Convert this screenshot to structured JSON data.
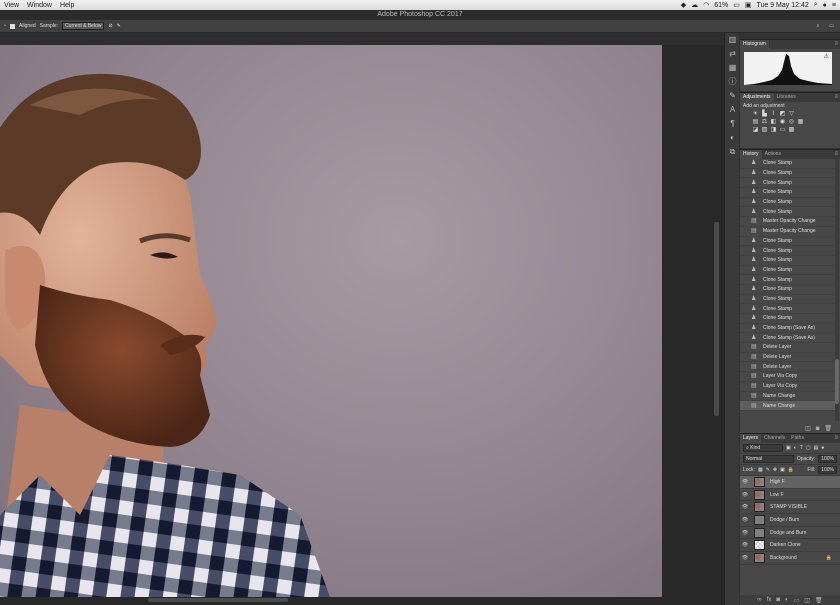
{
  "menubar": {
    "items": [
      "View",
      "Window",
      "Help"
    ],
    "status": {
      "battery": "61%",
      "datetime": "Tue 9 May  12:42"
    }
  },
  "window": {
    "title": "Adobe Photoshop CC 2017"
  },
  "options": {
    "aligned_label": "Aligned",
    "sample_label": "Sample:",
    "sample_value": "Current & Below"
  },
  "histogram": {
    "tab": "Histogram"
  },
  "adjustments": {
    "tabs": [
      "Adjustments",
      "Libraries"
    ],
    "title": "Add an adjustment"
  },
  "history": {
    "tabs": [
      "History",
      "Actions"
    ],
    "items": [
      "Clone Stamp",
      "Clone Stamp",
      "Clone Stamp",
      "Clone Stamp",
      "Clone Stamp",
      "Clone Stamp",
      "Master Opacity Change",
      "Master Opacity Change",
      "Clone Stamp",
      "Clone Stamp",
      "Clone Stamp",
      "Clone Stamp",
      "Clone Stamp",
      "Clone Stamp",
      "Clone Stamp",
      "Clone Stamp",
      "Clone Stamp",
      "Clone Stamp (Save As)",
      "Clone Stamp (Save As)",
      "Delete Layer",
      "Delete Layer",
      "Delete Layer",
      "Layer Via Copy",
      "Layer Via Copy",
      "Name Change",
      "Name Change"
    ]
  },
  "layers": {
    "tabs": [
      "Layers",
      "Channels",
      "Paths"
    ],
    "kind": "Kind",
    "blend_mode": "Normal",
    "opacity_label": "Opacity:",
    "opacity_value": "100%",
    "lock_label": "Lock:",
    "fill_label": "Fill:",
    "fill_value": "100%",
    "items": [
      "High F",
      "Low F",
      "STAMP VISIBLE",
      "Dodge / Burn",
      "Dodge and Burn",
      "Darken Clone",
      "Background"
    ]
  }
}
